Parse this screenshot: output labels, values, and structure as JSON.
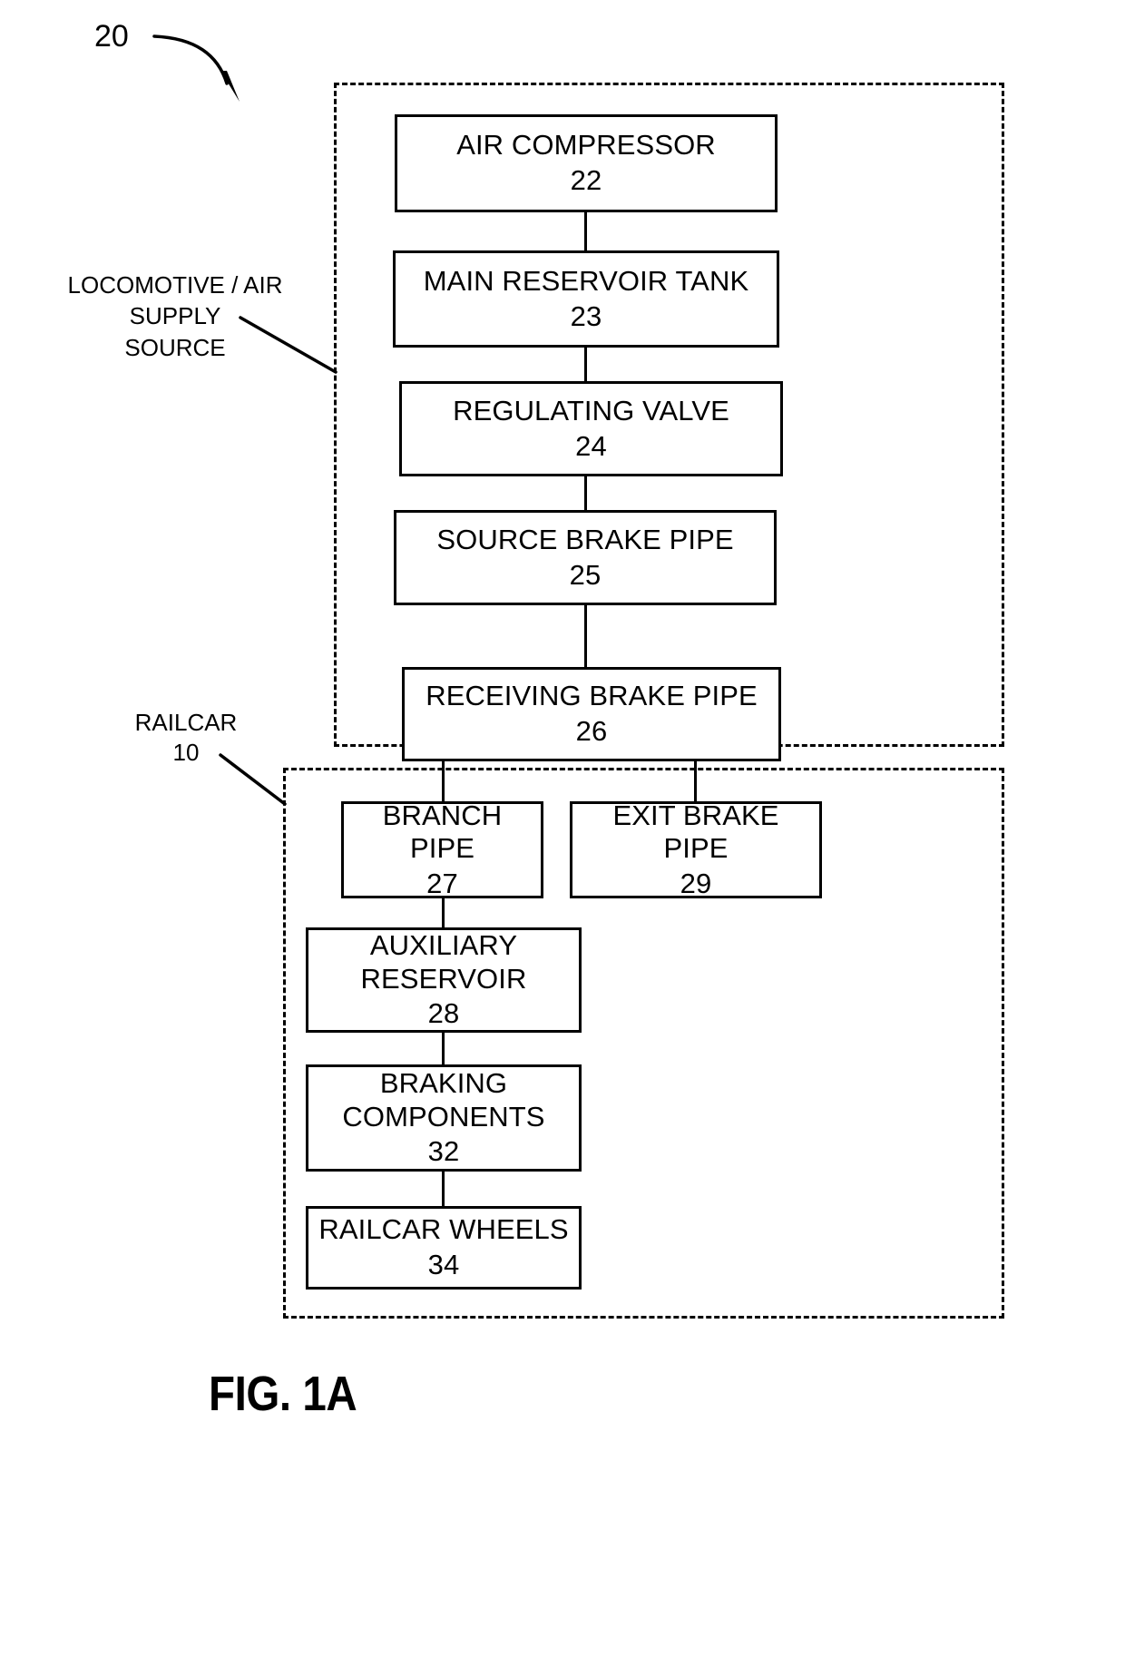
{
  "figure": {
    "caption": "FIG. 1A",
    "system_ref": "20"
  },
  "groups": [
    {
      "id": "locomotive",
      "label": "LOCOMOTIVE / AIR SUPPLY\nSOURCE",
      "ref": ""
    },
    {
      "id": "railcar",
      "label": "RAILCAR",
      "ref": "10"
    }
  ],
  "nodes": [
    {
      "id": "air-compressor",
      "label": "AIR COMPRESSOR",
      "ref": "22"
    },
    {
      "id": "main-reservoir-tank",
      "label": "MAIN RESERVOIR TANK",
      "ref": "23"
    },
    {
      "id": "regulating-valve",
      "label": "REGULATING VALVE",
      "ref": "24"
    },
    {
      "id": "source-brake-pipe",
      "label": "SOURCE BRAKE PIPE",
      "ref": "25"
    },
    {
      "id": "receiving-brake-pipe",
      "label": "RECEIVING BRAKE PIPE",
      "ref": "26"
    },
    {
      "id": "branch-pipe",
      "label": "BRANCH\nPIPE",
      "ref": "27"
    },
    {
      "id": "exit-brake-pipe",
      "label": "EXIT BRAKE\nPIPE",
      "ref": "29"
    },
    {
      "id": "auxiliary-reservoir",
      "label": "AUXILIARY\nRESERVOIR",
      "ref": "28"
    },
    {
      "id": "braking-components",
      "label": "BRAKING\nCOMPONENTS",
      "ref": "32"
    },
    {
      "id": "railcar-wheels",
      "label": "RAILCAR WHEELS",
      "ref": "34"
    }
  ],
  "chart_data": {
    "type": "diagram",
    "title": "FIG. 1A",
    "diagram_kind": "block-flow",
    "containers": [
      {
        "name": "LOCOMOTIVE / AIR SUPPLY SOURCE",
        "reference_numeral": "20",
        "style": "dashed",
        "members": [
          "22",
          "23",
          "24",
          "25"
        ]
      },
      {
        "name": "RAILCAR",
        "reference_numeral": "10",
        "style": "dashed",
        "members": [
          "26",
          "27",
          "29",
          "28",
          "32",
          "34"
        ]
      }
    ],
    "blocks": [
      {
        "ref": "22",
        "text": "AIR COMPRESSOR"
      },
      {
        "ref": "23",
        "text": "MAIN RESERVOIR TANK"
      },
      {
        "ref": "24",
        "text": "REGULATING VALVE"
      },
      {
        "ref": "25",
        "text": "SOURCE BRAKE PIPE"
      },
      {
        "ref": "26",
        "text": "RECEIVING BRAKE PIPE"
      },
      {
        "ref": "27",
        "text": "BRANCH PIPE"
      },
      {
        "ref": "29",
        "text": "EXIT BRAKE PIPE"
      },
      {
        "ref": "28",
        "text": "AUXILIARY RESERVOIR"
      },
      {
        "ref": "32",
        "text": "BRAKING COMPONENTS"
      },
      {
        "ref": "34",
        "text": "RAILCAR WHEELS"
      }
    ],
    "edges": [
      {
        "from": "22",
        "to": "23"
      },
      {
        "from": "23",
        "to": "24"
      },
      {
        "from": "24",
        "to": "25"
      },
      {
        "from": "25",
        "to": "26"
      },
      {
        "from": "26",
        "to": "27"
      },
      {
        "from": "26",
        "to": "29"
      },
      {
        "from": "27",
        "to": "28"
      },
      {
        "from": "28",
        "to": "32"
      },
      {
        "from": "32",
        "to": "34"
      }
    ]
  }
}
